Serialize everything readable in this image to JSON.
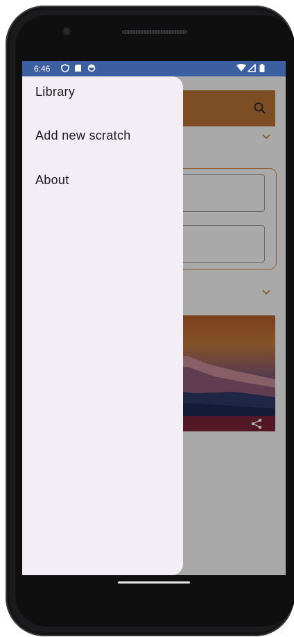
{
  "status_bar": {
    "time": "6:46",
    "left_icons": [
      "vpn-shield-icon",
      "sd-card-icon",
      "sync-icon"
    ],
    "right_icons": [
      "wifi-icon",
      "signal-icon",
      "battery-icon"
    ],
    "color": "#3b5fa0"
  },
  "drawer": {
    "items": [
      {
        "label": "Library"
      },
      {
        "label": "Add new scratch"
      },
      {
        "label": "About"
      }
    ],
    "background": "#f3eef5"
  },
  "app": {
    "toolbar_color": "#b97436",
    "accent": "#d18a45",
    "caption_color": "#7b2438",
    "icons": [
      "search-icon",
      "chevron-down-icon",
      "share-icon"
    ]
  }
}
